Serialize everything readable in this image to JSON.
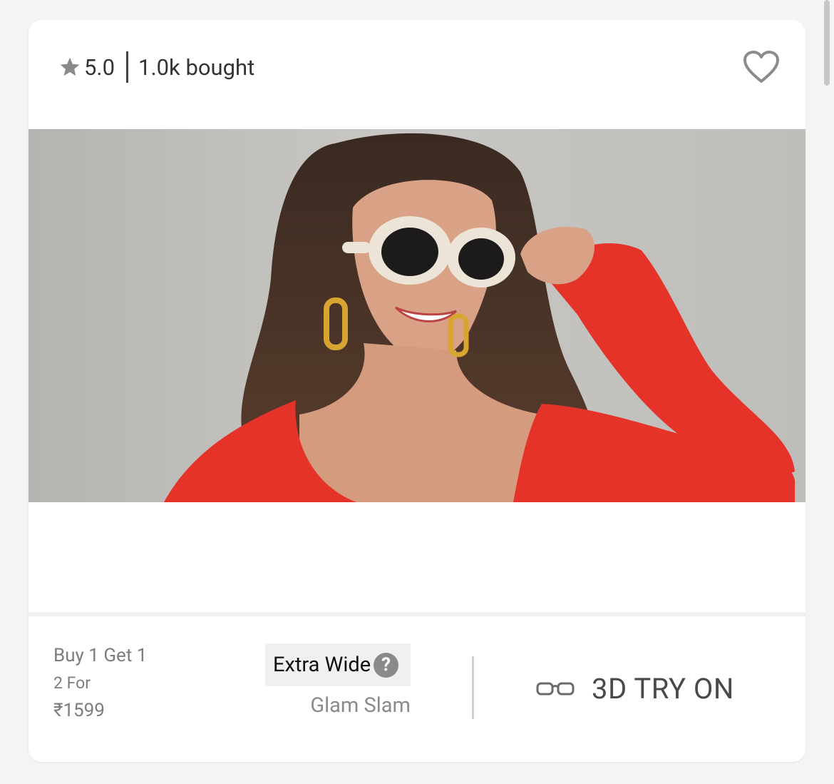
{
  "product": {
    "rating": "5.0",
    "bought": "1.0k bought",
    "width_tag": "Extra Wide",
    "help_glyph": "?",
    "collection": "Glam Slam"
  },
  "offer": {
    "line1": "Buy 1 Get 1",
    "line2": "2 For",
    "line3": "₹1599"
  },
  "tryon": {
    "label": "3D TRY ON"
  },
  "icons": {
    "rating": "star-icon",
    "wishlist": "heart-outline-icon",
    "help": "question-circle-icon",
    "tryon": "glasses-icon"
  }
}
